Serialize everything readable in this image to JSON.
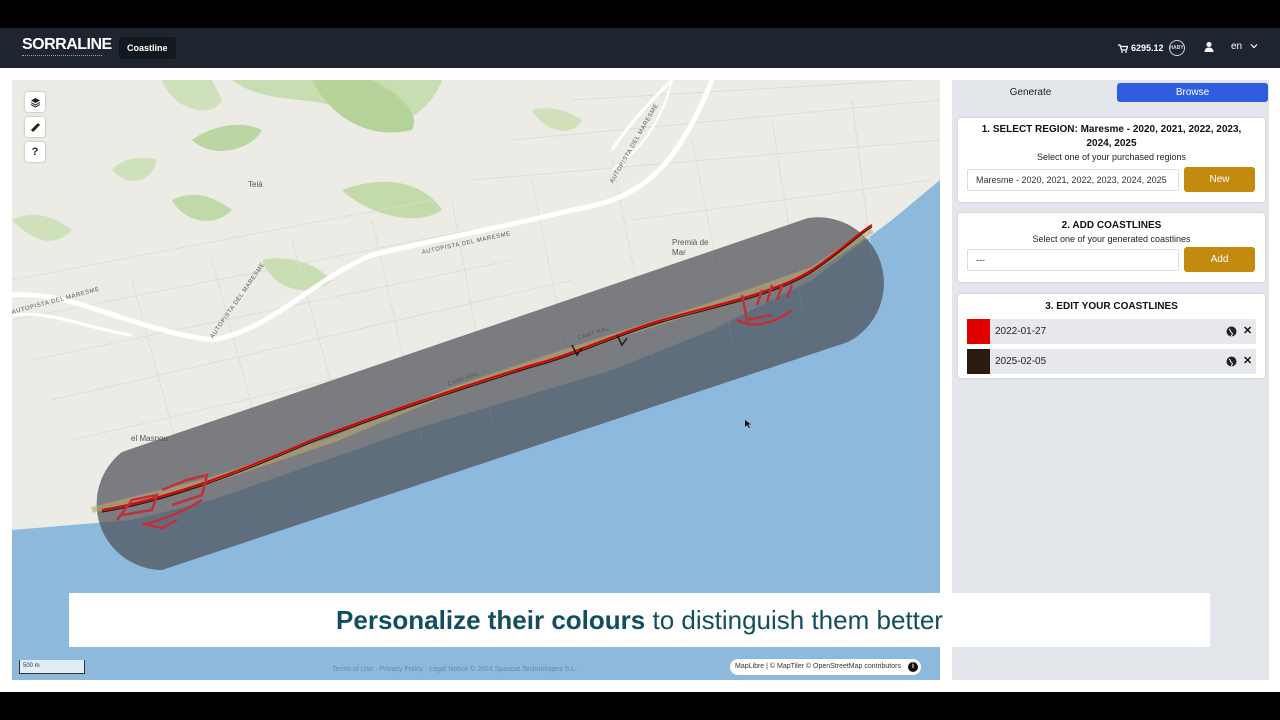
{
  "nav": {
    "logo": "SORRALINE",
    "coastline_button": "Coastline",
    "credits": "6295.12",
    "credit_badge": "HABY",
    "language": "en",
    "icons": {
      "cart": "cart-icon",
      "user": "user-icon",
      "chevron": "chevron-down-icon"
    }
  },
  "map": {
    "places": [
      "Teià",
      "Premià de Mar",
      "el Masnou"
    ],
    "roads": [
      "AUTOPISTA DEL MARESME",
      "AUTOPISTA DEL MARESME",
      "AUTOPISTA DEL MARESME",
      "AUTOPISTA DEL MARESME",
      "CAMÍ RAL",
      "CAMÍ RAL"
    ],
    "controls": {
      "layers": "layers-icon",
      "ruler": "ruler-icon",
      "help": "?"
    },
    "scale": "500 m",
    "footer": "Terms of Use  ·  Privacy Policy  ·  Legal Notice  © 2024 Spascat Technologies S.L.",
    "attribution": "MapLibre | © MapTiler © OpenStreetMap contributors",
    "info": "i"
  },
  "caption": {
    "bold": "Personalize their colours",
    "rest": " to distinguish them better"
  },
  "panel": {
    "tabs": {
      "generate": "Generate",
      "browse": "Browse"
    },
    "step1": {
      "title": "1. SELECT REGION: Maresme - 2020, 2021, 2022, 2023, 2024, 2025",
      "subtitle": "Select one of your purchased regions",
      "value": "Maresme - 2020, 2021, 2022, 2023, 2024, 2025",
      "button": "New"
    },
    "step2": {
      "title": "2. ADD COASTLINES",
      "subtitle": "Select one of your generated coastlines",
      "value": "---",
      "button": "Add"
    },
    "step3": {
      "title": "3. EDIT YOUR COASTLINES",
      "coastlines": [
        {
          "date": "2022-01-27",
          "color": "#e00000"
        },
        {
          "date": "2025-02-05",
          "color": "#2b1a0e"
        }
      ]
    }
  }
}
